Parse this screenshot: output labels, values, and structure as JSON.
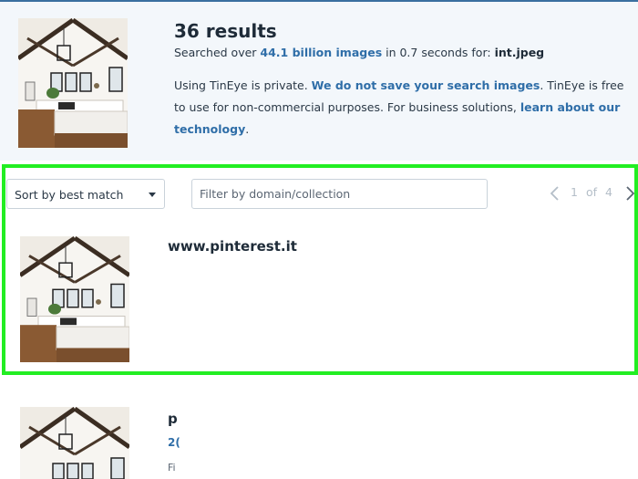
{
  "summary": {
    "results_count": "36 results",
    "searched_prefix": "Searched over ",
    "searched_link": "44.1 billion images",
    "searched_middle": " in 0.7 seconds for: ",
    "searched_file": "int.jpeg",
    "privacy_prefix": "Using TinEye is private. ",
    "privacy_link1": "We do not save your search images",
    "privacy_middle": ". TinEye is free to use for non-commercial purposes. For business solutions, ",
    "privacy_link2": "learn about our technology",
    "privacy_suffix": "."
  },
  "toolbar": {
    "sort_label": "Sort by best match",
    "filter_placeholder": "Filter by domain/collection",
    "page_current": "1",
    "page_of": "of",
    "page_total": "4"
  },
  "results": [
    {
      "domain": "www.pinterest.it"
    },
    {
      "domain_partial": "p",
      "date_partial": "2(",
      "meta_partial": "Fi"
    }
  ],
  "colors": {
    "accent": "#2f6ea8",
    "highlight": "#22ee22",
    "summary_bg": "#f3f7fb"
  }
}
